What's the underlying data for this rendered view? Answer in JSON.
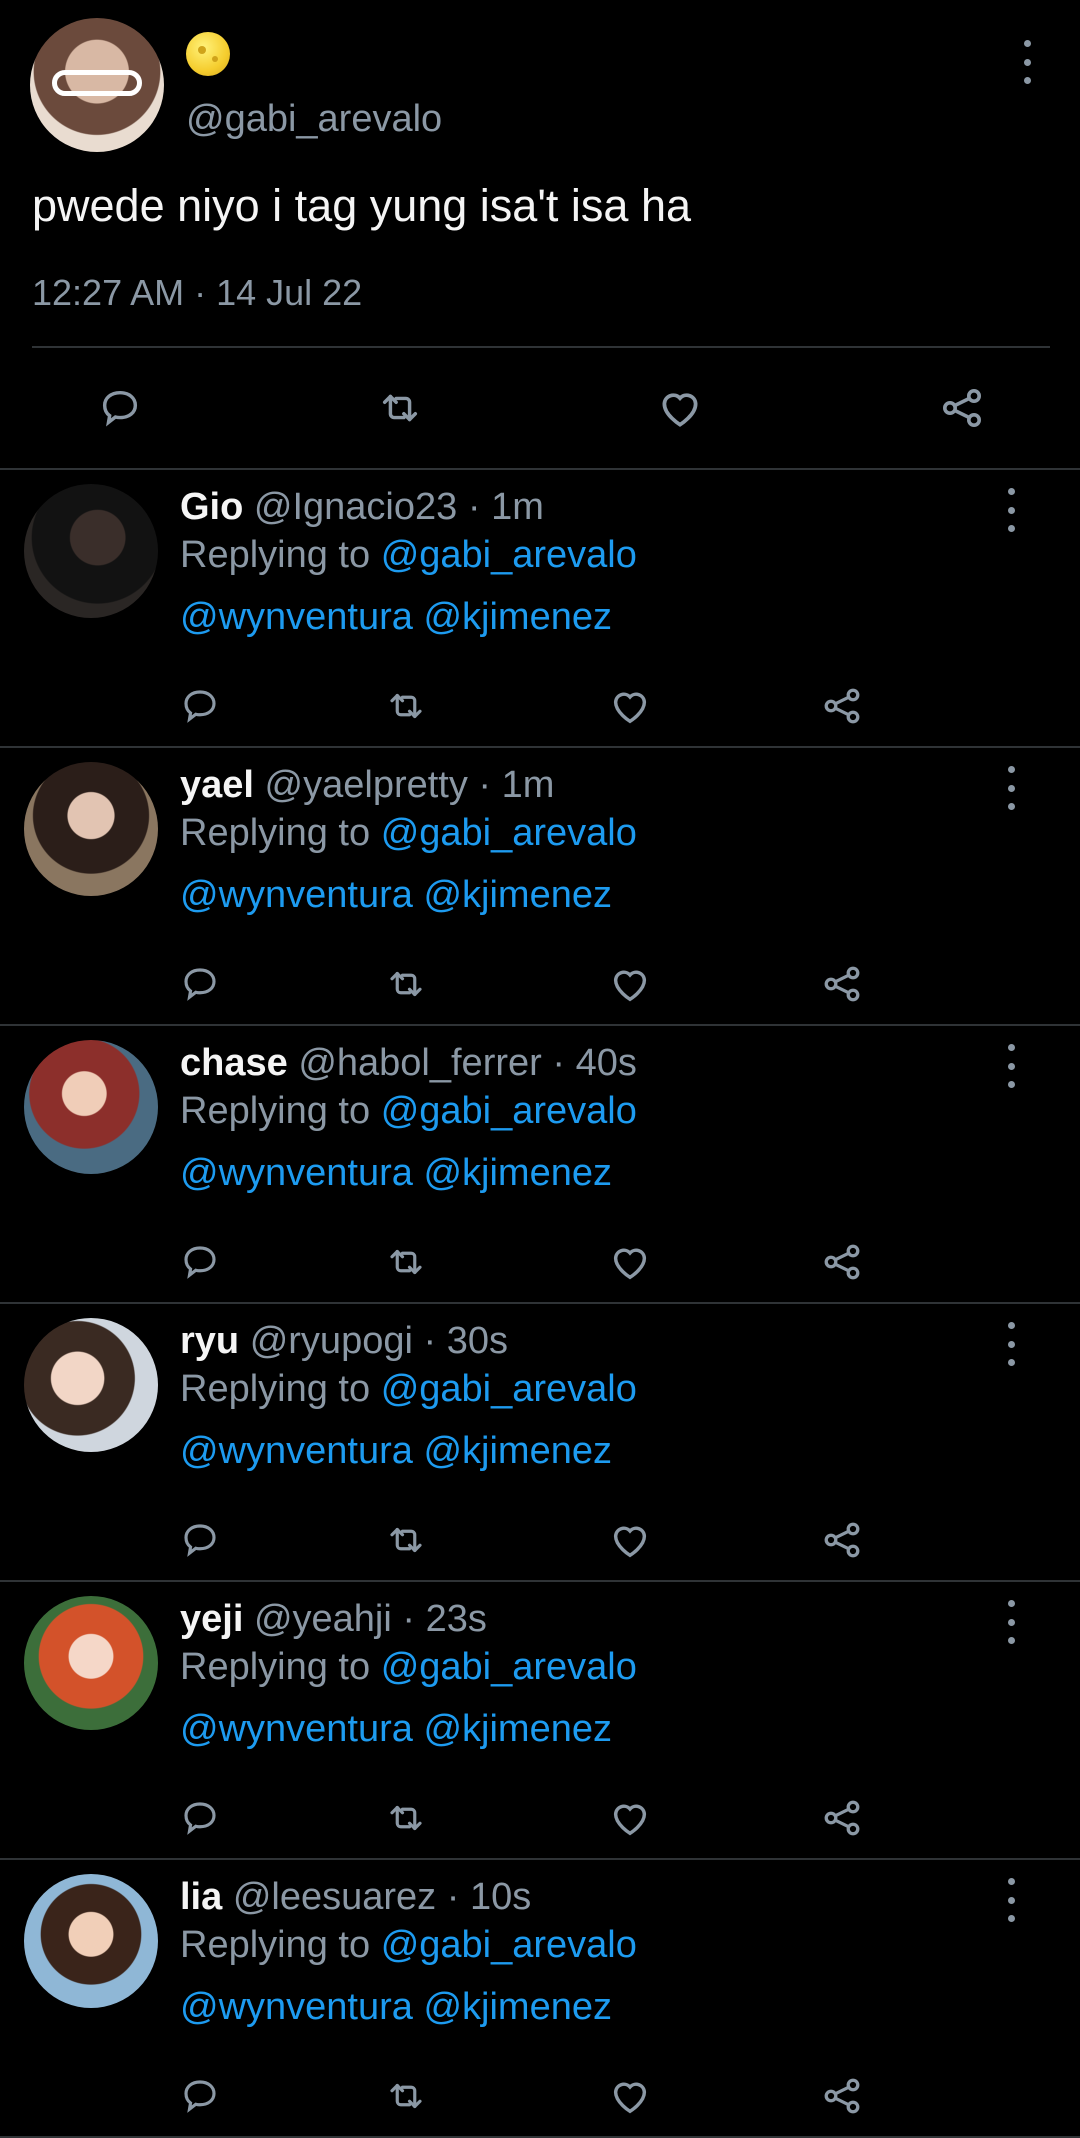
{
  "tweet": {
    "handle": "@gabi_arevalo",
    "text": "pwede niyo i tag yung isa't isa ha",
    "timestamp": "12:27 AM · 14 Jul 22"
  },
  "icons": {
    "reply": "reply-icon",
    "retweet": "retweet-icon",
    "like": "heart-icon",
    "share": "share-icon",
    "more": "more-options-icon"
  },
  "colors": {
    "background": "#000000",
    "link": "#1d9bf0",
    "muted": "#8b98a5",
    "divider": "#2f3336"
  },
  "replies": [
    {
      "name": "Gio",
      "handle": "@Ignacio23",
      "time": "1m",
      "replying_prefix": "Replying to",
      "replying_to": "@gabi_arevalo",
      "mentions": "@wynventura @kjimenez"
    },
    {
      "name": "yael",
      "handle": "@yaelpretty",
      "time": "1m",
      "replying_prefix": "Replying to",
      "replying_to": "@gabi_arevalo",
      "mentions": "@wynventura @kjimenez"
    },
    {
      "name": "chase",
      "handle": "@habol_ferrer",
      "time": "40s",
      "replying_prefix": "Replying to",
      "replying_to": "@gabi_arevalo",
      "mentions": "@wynventura @kjimenez"
    },
    {
      "name": "ryu",
      "handle": "@ryupogi",
      "time": "30s",
      "replying_prefix": "Replying to",
      "replying_to": "@gabi_arevalo",
      "mentions": "@wynventura @kjimenez"
    },
    {
      "name": "yeji",
      "handle": "@yeahji",
      "time": "23s",
      "replying_prefix": "Replying to",
      "replying_to": "@gabi_arevalo",
      "mentions": "@wynventura @kjimenez"
    },
    {
      "name": "lia",
      "handle": "@leesuarez",
      "time": "10s",
      "replying_prefix": "Replying to",
      "replying_to": "@gabi_arevalo",
      "mentions": "@wynventura @kjimenez"
    }
  ]
}
